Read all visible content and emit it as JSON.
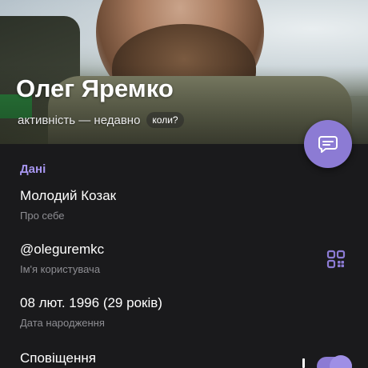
{
  "profile": {
    "name": "Олег Яремко",
    "status": "активність — недавно",
    "when_label": "коли?"
  },
  "details": {
    "section_title": "Дані",
    "bio": {
      "value": "Молодий Козак",
      "label": "Про себе"
    },
    "username": {
      "value": "@oleguremkc",
      "label": "Ім'я користувача"
    },
    "birthday": {
      "value": "08 лют. 1996 (29 років)",
      "label": "Дата народження"
    },
    "notifications": {
      "value": "Сповіщення",
      "enabled": true
    }
  },
  "icons": {
    "fab": "message-icon",
    "username_action": "qr-code-icon"
  },
  "colors": {
    "accent": "#8c7bd4",
    "section_title": "#a796f0",
    "background": "#1a1a1c",
    "secondary_text": "#8e8e93"
  }
}
